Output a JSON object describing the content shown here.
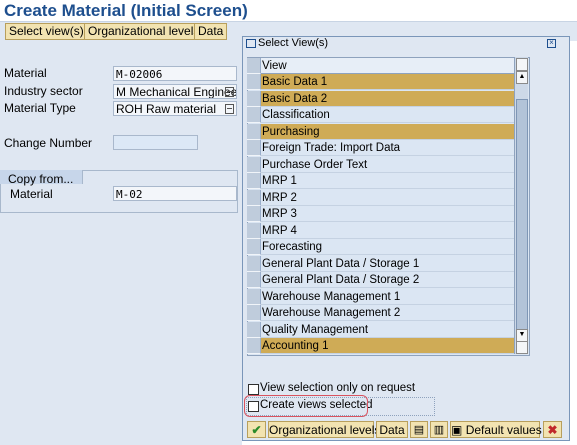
{
  "window": {
    "title": "Create Material (Initial Screen)"
  },
  "toolbar": {
    "select_views": "Select view(s)",
    "org_levels": "Organizational levels",
    "data": "Data"
  },
  "form": {
    "material_label": "Material",
    "material_value": "M-02006",
    "industry_label": "Industry sector",
    "industry_value": "M Mechanical Engineeri",
    "type_label": "Material Type",
    "type_value": "ROH Raw material",
    "change_label": "Change Number",
    "change_value": ""
  },
  "copy_from": {
    "title": "Copy from...",
    "material_label": "Material",
    "material_value": "M-02"
  },
  "dialog": {
    "title": "Select View(s)",
    "column_header": "View",
    "views": [
      {
        "label": "Basic Data 1",
        "selected": true
      },
      {
        "label": "Basic Data 2",
        "selected": true
      },
      {
        "label": "Classification",
        "selected": false
      },
      {
        "label": "Purchasing",
        "selected": true
      },
      {
        "label": "Foreign Trade: Import Data",
        "selected": false
      },
      {
        "label": "Purchase Order Text",
        "selected": false
      },
      {
        "label": "MRP 1",
        "selected": false
      },
      {
        "label": "MRP 2",
        "selected": false
      },
      {
        "label": "MRP 3",
        "selected": false
      },
      {
        "label": "MRP 4",
        "selected": false
      },
      {
        "label": "Forecasting",
        "selected": false
      },
      {
        "label": "General Plant Data / Storage 1",
        "selected": false
      },
      {
        "label": "General Plant Data / Storage 2",
        "selected": false
      },
      {
        "label": "Warehouse Management 1",
        "selected": false
      },
      {
        "label": "Warehouse Management 2",
        "selected": false
      },
      {
        "label": "Quality Management",
        "selected": false
      },
      {
        "label": "Accounting 1",
        "selected": true
      }
    ],
    "checkbox_on_request": {
      "label": "View selection only on request",
      "checked": false
    },
    "checkbox_create_selected": {
      "label": "Create views selected",
      "checked": false
    },
    "buttons": {
      "org_levels": "Organizational levels",
      "data": "Data",
      "default_values": "Default values"
    }
  },
  "colors": {
    "title": "#1e4f8e",
    "selected_row": "#cfab56",
    "button": "#f2e3b1",
    "highlight": "#d9535f"
  }
}
